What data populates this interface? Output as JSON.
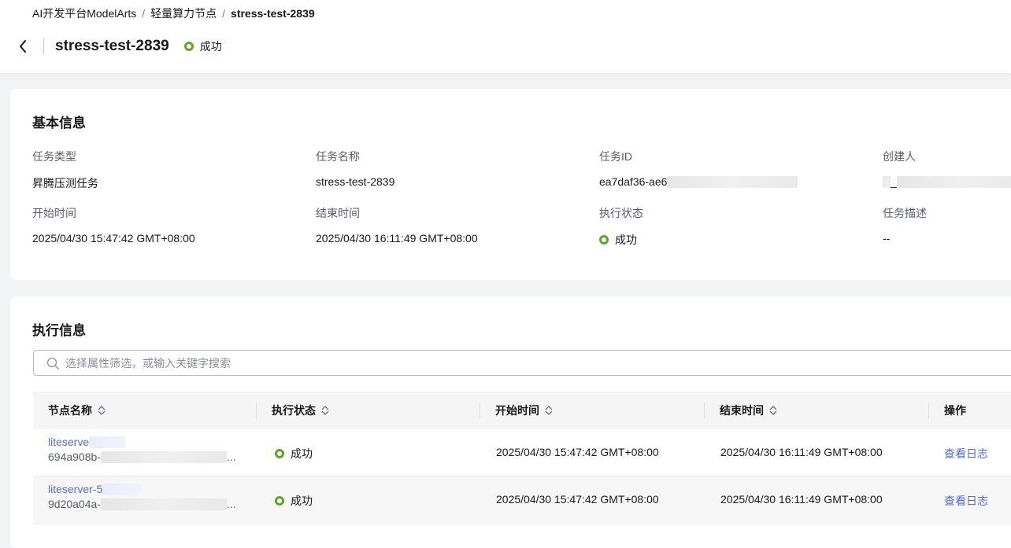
{
  "breadcrumb": {
    "items": [
      "AI开发平台ModelArts",
      "轻量算力节点"
    ],
    "separator": "/",
    "current": "stress-test-2839"
  },
  "header": {
    "title": "stress-test-2839",
    "status": "成功"
  },
  "basic_info": {
    "title": "基本信息",
    "fields": {
      "task_type": {
        "label": "任务类型",
        "value": "昇腾压测任务"
      },
      "task_name": {
        "label": "任务名称",
        "value": "stress-test-2839"
      },
      "task_id": {
        "label": "任务ID",
        "value": "ea7daf36-ae6"
      },
      "creator": {
        "label": "创建人",
        "value": "_"
      },
      "start_time": {
        "label": "开始时间",
        "value": "2025/04/30 15:47:42 GMT+08:00"
      },
      "end_time": {
        "label": "结束时间",
        "value": "2025/04/30 16:11:49 GMT+08:00"
      },
      "exec_status": {
        "label": "执行状态",
        "value": "成功"
      },
      "description": {
        "label": "任务描述",
        "value": "--"
      }
    }
  },
  "exec_info": {
    "title": "执行信息",
    "search_placeholder": "选择属性筛选，或输入关键字搜索",
    "columns": [
      "节点名称",
      "执行状态",
      "开始时间",
      "结束时间",
      "操作"
    ],
    "rows": [
      {
        "name": "liteserve",
        "id": "694a908b-",
        "status": "成功",
        "start": "2025/04/30 15:47:42 GMT+08:00",
        "end": "2025/04/30 16:11:49 GMT+08:00",
        "action": "查看日志"
      },
      {
        "name": "liteserver-5",
        "id": "9d20a04a-",
        "status": "成功",
        "start": "2025/04/30 15:47:42 GMT+08:00",
        "end": "2025/04/30 16:11:49 GMT+08:00",
        "action": "查看日志"
      }
    ]
  },
  "colors": {
    "success": "#5fa52a",
    "link": "#526ecc"
  }
}
